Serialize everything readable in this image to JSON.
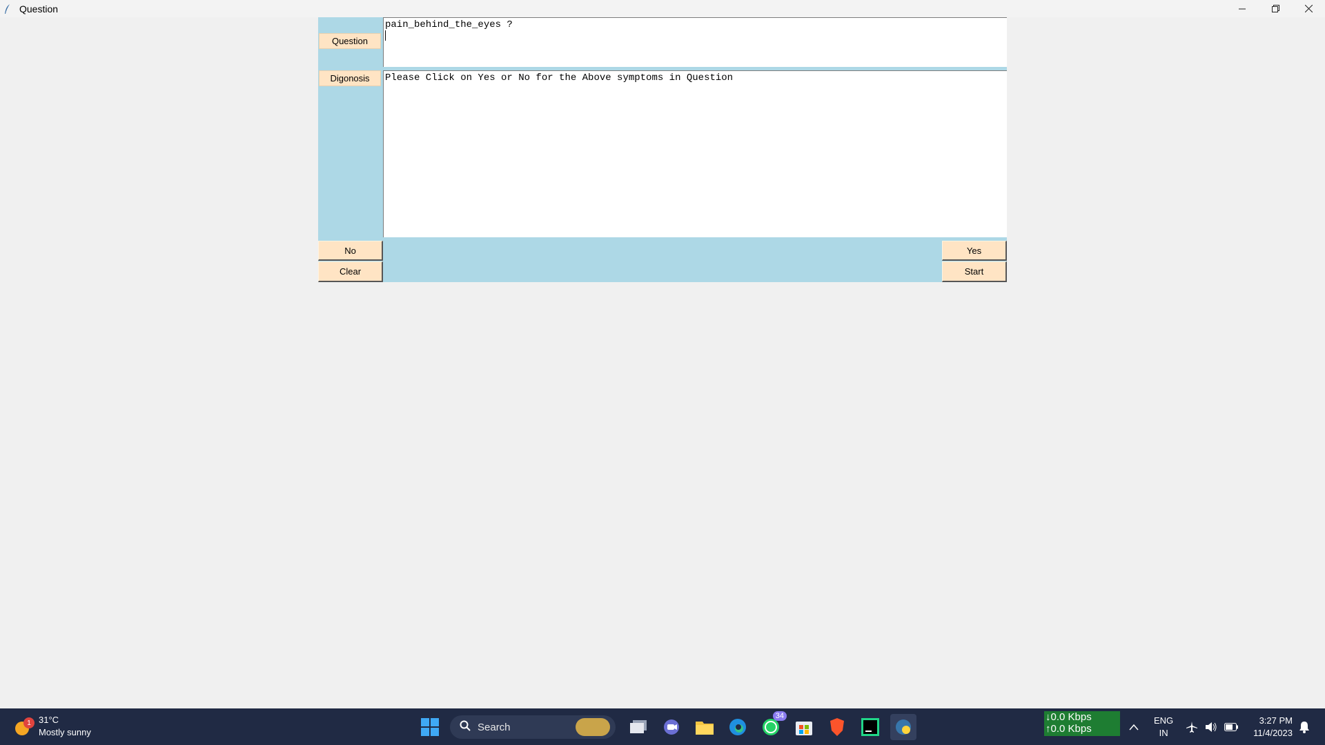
{
  "window": {
    "title": "Question",
    "controls": [
      "minimize-icon",
      "restore-icon",
      "close-icon"
    ]
  },
  "form": {
    "question_label": "Question",
    "diagnosis_label": "Digonosis",
    "question_text": "pain_behind_the_eyes ?",
    "diagnosis_text": "Please Click on Yes or No for the Above symptoms in Question",
    "buttons": {
      "no": "No",
      "clear": "Clear",
      "yes": "Yes",
      "start": "Start"
    }
  },
  "colors": {
    "frame_bg": "#add8e6",
    "button_bg": "#ffe4c4",
    "taskbar_bg": "#202a44",
    "network_bg": "#1e7d32"
  },
  "taskbar": {
    "weather": {
      "badge": "1",
      "temp": "31°C",
      "condition": "Mostly sunny"
    },
    "search_label": "Search",
    "whatsapp_badge": "34",
    "network": {
      "down": "0.0 Kbps",
      "up": "0.0 Kbps"
    },
    "language": "ENG",
    "region": "IN",
    "time": "3:27 PM",
    "date": "11/4/2023"
  }
}
